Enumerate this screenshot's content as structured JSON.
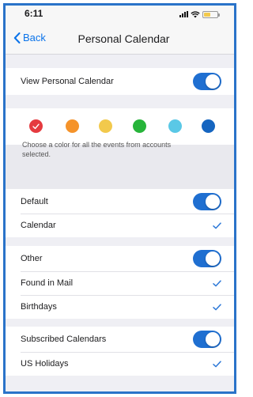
{
  "status_bar": {
    "time": "6:11"
  },
  "nav": {
    "back_label": "Back",
    "title": "Personal Calendar"
  },
  "view_row": {
    "label": "View Personal Calendar",
    "toggle_on": true
  },
  "colors": {
    "options": [
      {
        "name": "red",
        "hex": "#e53a3f",
        "selected": true
      },
      {
        "name": "orange",
        "hex": "#f5932a",
        "selected": false
      },
      {
        "name": "yellow",
        "hex": "#f2c94c",
        "selected": false
      },
      {
        "name": "green",
        "hex": "#27b43a",
        "selected": false
      },
      {
        "name": "light-blue",
        "hex": "#5ac8e6",
        "selected": false
      },
      {
        "name": "blue",
        "hex": "#1565c0",
        "selected": false
      }
    ],
    "hint": "Choose a color for all the events from accounts selected."
  },
  "sections": {
    "default": {
      "header": "Default",
      "toggle_on": true,
      "items": [
        {
          "label": "Calendar",
          "checked": true
        }
      ]
    },
    "other": {
      "header": "Other",
      "toggle_on": true,
      "items": [
        {
          "label": "Found in Mail",
          "checked": true
        },
        {
          "label": "Birthdays",
          "checked": true
        }
      ]
    },
    "subscribed": {
      "header": "Subscribed Calendars",
      "toggle_on": true,
      "items": [
        {
          "label": "US Holidays",
          "checked": true
        }
      ]
    }
  },
  "theme": {
    "accent": "#0a73ea",
    "toggle_on": "#1f6fd1",
    "check": "#2f7ad8"
  }
}
